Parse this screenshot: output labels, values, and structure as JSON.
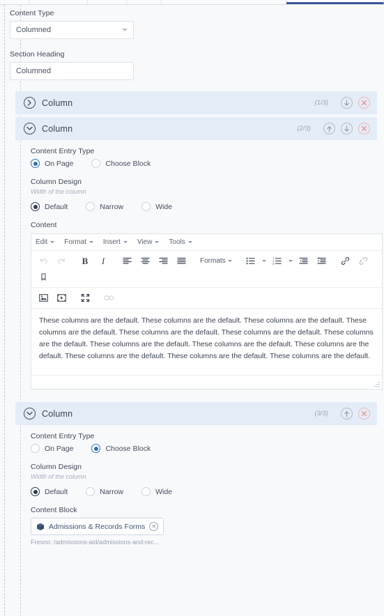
{
  "tabbar": {
    "segments": 5,
    "active_index": 4
  },
  "form": {
    "content_type": {
      "label": "Content Type",
      "value": "Columned",
      "icon": "chevron-down-icon"
    },
    "section_heading": {
      "label": "Section Heading",
      "value": "Columned",
      "placeholder": "Section Heading"
    }
  },
  "labels": {
    "content_entry_type": "Content Entry Type",
    "column_design": "Column Design",
    "column_design_hint": "Width of the column",
    "content": "Content",
    "content_block": "Content Block",
    "on_page": "On Page",
    "choose_block": "Choose Block",
    "default": "Default",
    "narrow": "Narrow",
    "wide": "Wide",
    "column_title": "Column"
  },
  "columns": [
    {
      "title": "Column",
      "count": "(1/3)",
      "expanded": false,
      "chevron": "chevron-right-icon",
      "actions": [
        "move-down",
        "delete"
      ]
    },
    {
      "title": "Column",
      "count": "(2/3)",
      "expanded": true,
      "chevron": "chevron-down-icon",
      "actions": [
        "move-up",
        "move-down",
        "delete"
      ],
      "entry_type_selected": "on_page",
      "design_selected": "default",
      "editor": {
        "menus": [
          "Edit",
          "Format",
          "Insert",
          "View",
          "Tools"
        ],
        "formats_label": "Formats",
        "body_text": "These columns are the default. These columns are the default. These columns are the default. These columns are the default. These columns are the default. These columns are the default. These columns are the default. These columns are the default. These columns are the default. These columns are the default. These columns are the default. These columns are the default. These columns are the default."
      }
    },
    {
      "title": "Column",
      "count": "(3/3)",
      "expanded": true,
      "chevron": "chevron-down-icon",
      "actions": [
        "move-up",
        "delete"
      ],
      "entry_type_selected": "choose_block",
      "design_selected": "default",
      "content_block": {
        "name": "Admissions & Records Forms",
        "path": "Fresno: /admissions-aid/admissions-and-rec..."
      }
    }
  ],
  "colors": {
    "header_bg": "#e4edf7",
    "accent_blue": "#2f6fb5",
    "radio_dark": "#2c3a52",
    "delete_red": "#e88b8b",
    "page_bg": "#f7f9fb"
  }
}
